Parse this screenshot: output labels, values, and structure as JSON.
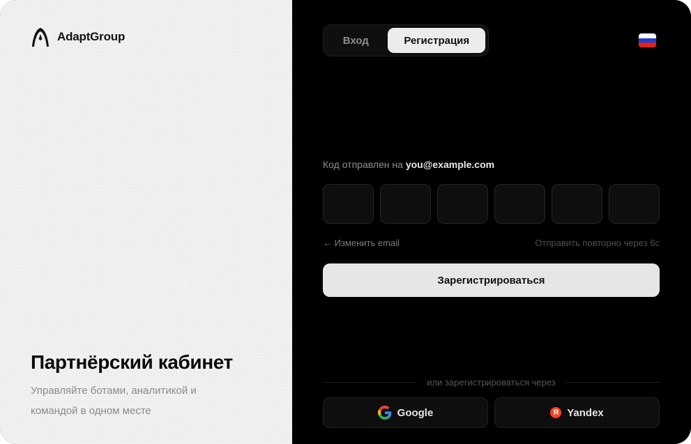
{
  "brand": {
    "name": "AdaptGroup",
    "logo_icon": "adapt-logo-icon"
  },
  "promo": {
    "title": "Партнёрский кабинет",
    "subtitle_line1": "Управляйте ботами, аналитикой и",
    "subtitle_line2": "командой в одном месте"
  },
  "tabs": [
    {
      "label": "Вход",
      "active": false
    },
    {
      "label": "Регистрация",
      "active": true
    }
  ],
  "language": {
    "flag": "russia-flag-icon",
    "colors": [
      "#ffffff",
      "#1c3fd1",
      "#e2231a"
    ]
  },
  "verification": {
    "sent_prefix": "Код отправлен на",
    "email": "you@example.com",
    "code_cells": [
      "",
      "",
      "",
      "",
      "",
      ""
    ],
    "change_email": "← Изменить email",
    "resend": "Отправить повторно через 6с"
  },
  "submit_label": "Зарегистрироваться",
  "divider_text": "или зарегистрироваться через",
  "social": [
    {
      "label": "Google",
      "icon": "google-icon"
    },
    {
      "label": "Yandex",
      "icon": "yandex-icon",
      "icon_glyph": "Я"
    }
  ],
  "colors": {
    "accent_light": "#e6e6e6",
    "panel_dark": "#000000",
    "panel_light": "#f3f3f3",
    "yandex_red": "#fc3f1d"
  }
}
